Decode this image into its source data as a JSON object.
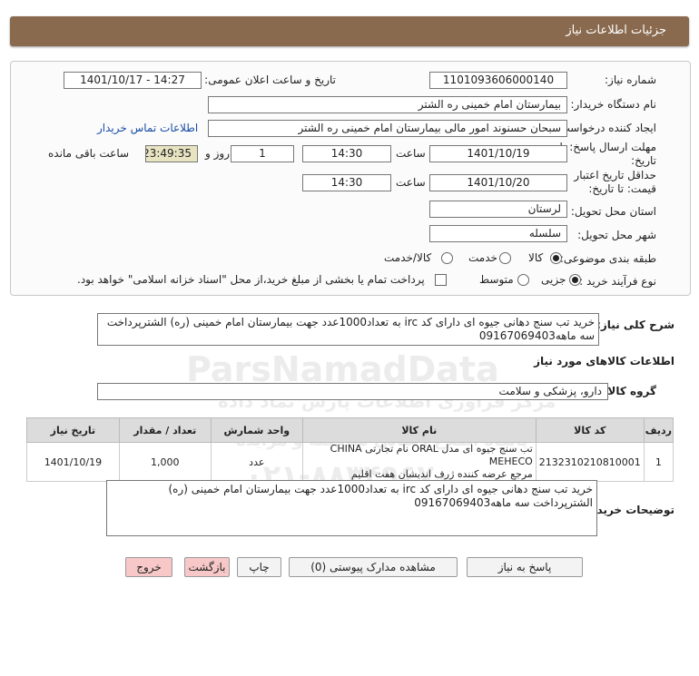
{
  "header": {
    "title": "جزئیات اطلاعات نیاز"
  },
  "form": {
    "need_number_label": "شماره نیاز:",
    "need_number": "1101093606000140",
    "announce_label": "تاریخ و ساعت اعلان عمومی:",
    "announce_value": "1401/10/17 - 14:27",
    "buyer_org_label": "نام دستگاه خریدار:",
    "buyer_org": "بیمارستان امام خمینی ره الشتر",
    "creator_label": "ایجاد کننده درخواست:",
    "creator": "سبحان حسنوند امور مالی بیمارستان امام خمینی ره الشتر",
    "contact_link": "اطلاعات تماس خریدار",
    "reply_deadline_label_1": "مهلت ارسال پاسخ: تا",
    "reply_deadline_label_2": "تاریخ:",
    "reply_date": "1401/10/19",
    "time_label": "ساعت",
    "reply_time": "14:30",
    "days_value": "1",
    "days_label": "روز و",
    "remaining_time": "23:49:35",
    "remaining_label": "ساعت باقی مانده",
    "validity_label_1": "حداقل تاریخ اعتبار",
    "validity_label_2": "قیمت: تا تاریخ:",
    "validity_date": "1401/10/20",
    "validity_time": "14:30",
    "province_label": "استان محل تحویل:",
    "province": "لرستان",
    "city_label": "شهر محل تحویل:",
    "city": "سلسله",
    "category_label": "طبقه بندی موضوعی:",
    "category_options": [
      "کالا",
      "خدمت",
      "کالا/خدمت"
    ],
    "category_selected": "کالا",
    "process_label": "نوع فرآیند خرید :",
    "process_options": [
      "جزیی",
      "متوسط"
    ],
    "process_selected": "جزیی",
    "payment_note": "پرداخت تمام یا بخشی از مبلغ خرید،از محل \"اسناد خزانه اسلامی\" خواهد بود."
  },
  "summary": {
    "label": "شرح کلی نیاز:",
    "text": "خرید تب سنج دهانی جیوه ای دارای کد irc به تعداد1000عدد جهت بیمارستان امام خمینی (ره) الشترپرداخت سه ماهه09167069403"
  },
  "goods_info_title": "اطلاعات کالاهای مورد نیاز",
  "goods_group": {
    "label": "گروه کالا:",
    "value": "دارو، پزشکی و سلامت"
  },
  "table": {
    "headers": [
      "ردیف",
      "کد کالا",
      "نام کالا",
      "واحد شمارش",
      "تعداد / مقدار",
      "تاریخ نیاز"
    ],
    "rows": [
      {
        "row": "1",
        "code": "2132310210810001",
        "name_line1": "تب سنج جیوه ای مدل ORAL نام تجارتی CHINA MEHECO",
        "name_line2": "مرجع عرضه کننده ژرف اندیشان هفت اقلیم",
        "unit": "عدد",
        "qty": "1,000",
        "date": "1401/10/19"
      }
    ]
  },
  "notes": {
    "label": "توضیحات خریدار:",
    "text": "خرید تب سنج دهانی جیوه ای دارای کد irc به تعداد1000عدد جهت بیمارستان امام خمینی (ره) الشترپرداخت سه ماهه09167069403"
  },
  "buttons": {
    "reply": "پاسخ به نیاز",
    "attachments": "مشاهده مدارک پیوستی (0)",
    "print": "چاپ",
    "back": "بازگشت",
    "exit": "خروج"
  },
  "watermark": {
    "brand": "ParsNamadData",
    "tagline": "مرکز فراوری اطلاعات پارس نماد داده",
    "tagline2": "پایگاه اطلاع رسانی مناقصه و مزایده",
    "phone": "۰۲۱-۸۸۳۴۹۶۷۰"
  }
}
